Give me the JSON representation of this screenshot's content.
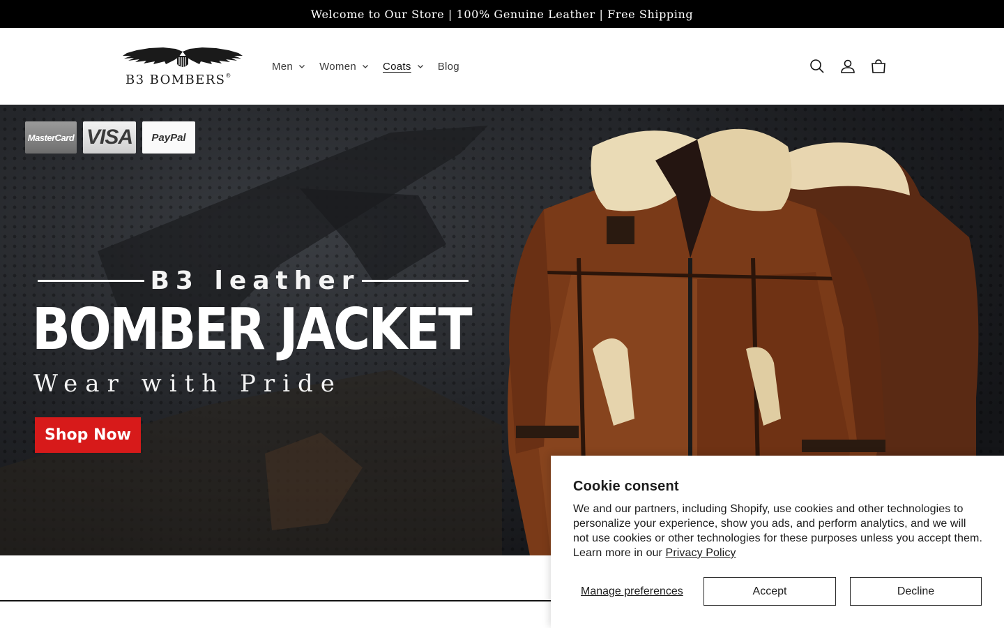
{
  "announcement": {
    "text": "Welcome to Our Store | 100% Genuine Leather | Free Shipping"
  },
  "header": {
    "logo": {
      "text": "B3 BOMBERS",
      "registered": "®"
    },
    "nav": [
      {
        "label": "Men",
        "dropdown": true
      },
      {
        "label": "Women",
        "dropdown": true
      },
      {
        "label": "Coats",
        "dropdown": true,
        "active": true
      },
      {
        "label": "Blog",
        "dropdown": false
      }
    ],
    "icons": [
      "search-icon",
      "account-icon",
      "cart-icon"
    ]
  },
  "hero": {
    "payment_cards": [
      "MasterCard",
      "VISA",
      "PayPal"
    ],
    "subheading": "B3 leather",
    "headline": "BOMBER JACKET",
    "tagline": "Wear with Pride",
    "cta": "Shop Now",
    "accent_color": "#d71a1a"
  },
  "cookie": {
    "title": "Cookie consent",
    "body": "We and our partners, including Shopify, use cookies and other technologies to personalize your experience, show you ads, and perform analytics, and we will not use cookies or other technologies for these purposes unless you accept them. Learn more in our",
    "privacy_link": "Privacy Policy",
    "manage_label": "Manage preferences",
    "accept_label": "Accept",
    "decline_label": "Decline"
  }
}
